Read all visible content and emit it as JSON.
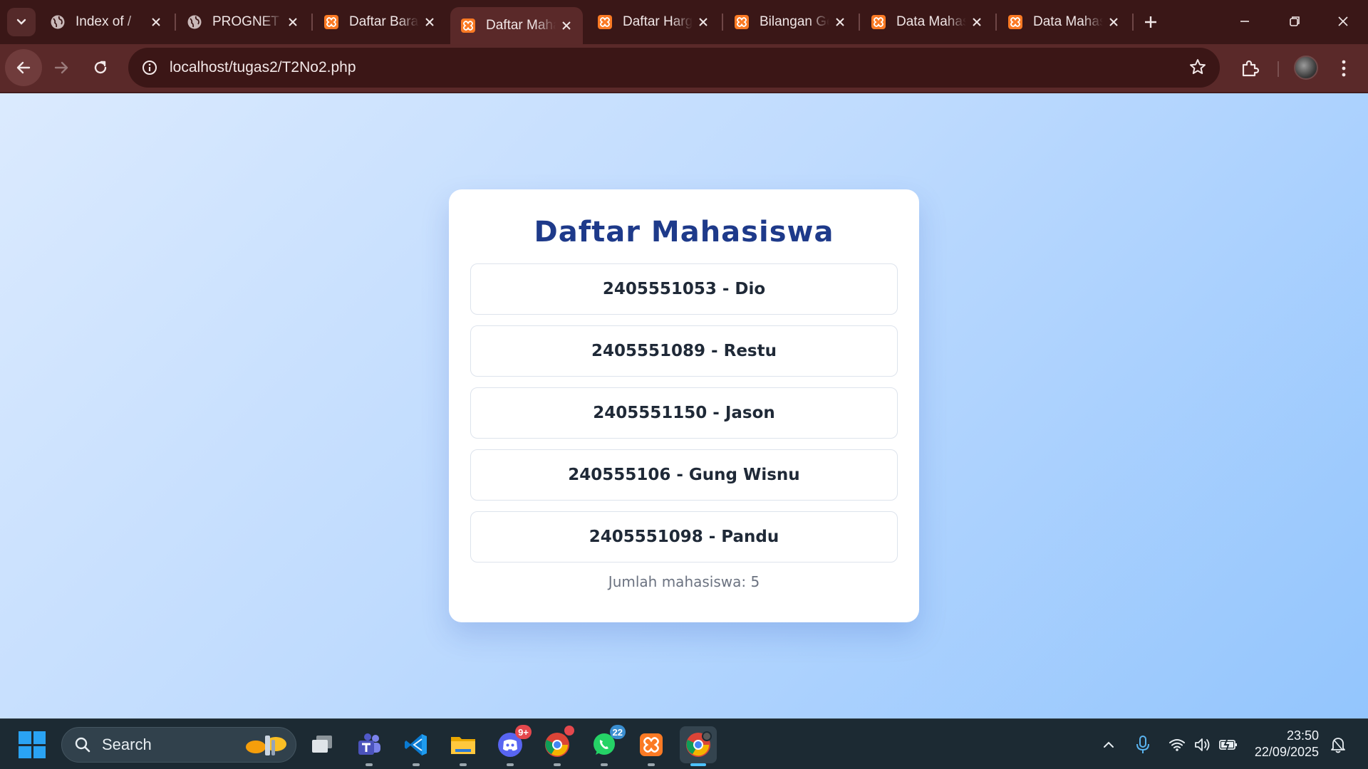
{
  "browser": {
    "tabs": [
      {
        "title": "Index of /",
        "favicon": "globe-icon",
        "active": false
      },
      {
        "title": "PROGNET",
        "favicon": "globe-icon",
        "active": false
      },
      {
        "title": "Daftar Barang",
        "favicon": "xampp-icon",
        "active": false
      },
      {
        "title": "Daftar Mahasiswa",
        "favicon": "xampp-icon",
        "active": true
      },
      {
        "title": "Daftar Harga",
        "favicon": "xampp-icon",
        "active": false
      },
      {
        "title": "Bilangan Genap",
        "favicon": "xampp-icon",
        "active": false
      },
      {
        "title": "Data Mahasiswa",
        "favicon": "xampp-icon",
        "active": false
      },
      {
        "title": "Data Mahasiswa",
        "favicon": "xampp-icon",
        "active": false
      }
    ],
    "url": "localhost/tugas2/T2No2.php",
    "colors": {
      "frame": "#3a1717",
      "toolbar": "#5a2929",
      "omnibox": "#3b1616"
    }
  },
  "page": {
    "title": "Daftar Mahasiswa",
    "students": [
      {
        "label": "2405551053 - Dio"
      },
      {
        "label": "2405551089 - Restu"
      },
      {
        "label": "2405551150 - Jason"
      },
      {
        "label": "240555106 - Gung Wisnu"
      },
      {
        "label": "2405551098 - Pandu"
      }
    ],
    "footer": "Jumlah mahasiswa: 5",
    "colors": {
      "title": "#1e3a8a",
      "background_start": "#dbeafe",
      "background_end": "#93c5fd"
    }
  },
  "taskbar": {
    "search_label": "Search",
    "apps": [
      {
        "name": "task-view"
      },
      {
        "name": "teams"
      },
      {
        "name": "vscode"
      },
      {
        "name": "file-explorer"
      },
      {
        "name": "discord",
        "badge": "9+"
      },
      {
        "name": "chrome-profile"
      },
      {
        "name": "whatsapp",
        "badge": "22"
      },
      {
        "name": "xampp"
      },
      {
        "name": "chrome",
        "active": true
      }
    ],
    "time": "23:50",
    "date": "22/09/2025"
  }
}
